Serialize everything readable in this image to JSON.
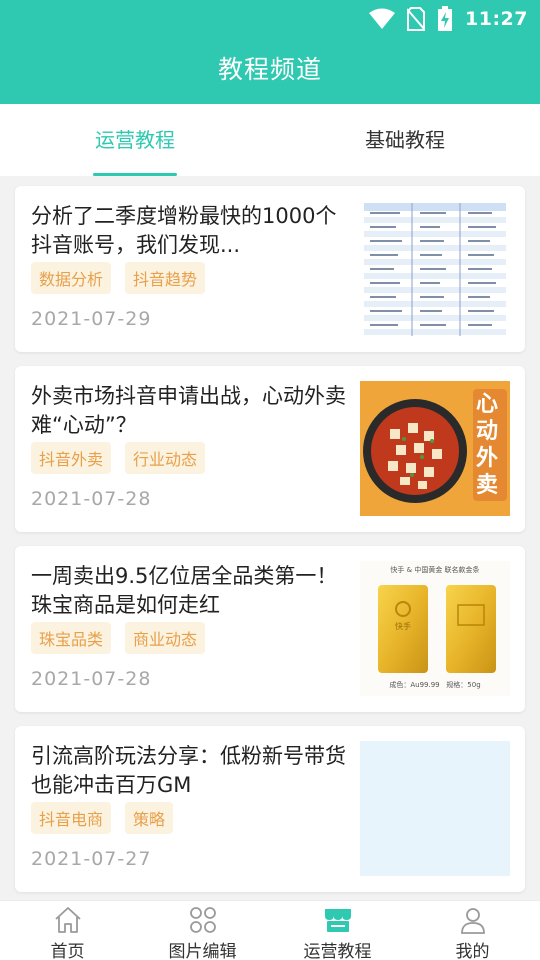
{
  "status_bar": {
    "time": "11:27"
  },
  "header": {
    "title": "教程频道"
  },
  "tabs": [
    {
      "label": "运营教程",
      "active": true
    },
    {
      "label": "基础教程",
      "active": false
    }
  ],
  "articles": [
    {
      "title": "分析了二季度增粉最快的1000个抖音账号，我们发现...",
      "tags": [
        "数据分析",
        "抖音趋势"
      ],
      "date": "2021-07-29",
      "thumb": "data-table"
    },
    {
      "title": "外卖市场抖音申请出战，心动外卖难“心动”？",
      "tags": [
        "抖音外卖",
        "行业动态"
      ],
      "date": "2021-07-28",
      "thumb": "food",
      "thumb_text": "心动外卖"
    },
    {
      "title": "一周卖出9.5亿位居全品类第一！珠宝商品是如何走红",
      "tags": [
        "珠宝品类",
        "商业动态"
      ],
      "date": "2021-07-28",
      "thumb": "gold-bars",
      "thumb_header": "快手 & 中国黄金 联名款金条",
      "thumb_footer": "成色：Au99.99   规格：50g",
      "bar_brand": "快手"
    },
    {
      "title": "引流高阶玩法分享：低粉新号带货也能冲击百万GM",
      "tags": [
        "抖音电商",
        "策略"
      ],
      "date": "2021-07-27",
      "thumb": "blank"
    }
  ],
  "bottom_nav": [
    {
      "label": "首页",
      "icon": "home-icon",
      "active": false
    },
    {
      "label": "图片编辑",
      "icon": "grid-icon",
      "active": false
    },
    {
      "label": "运营教程",
      "icon": "shop-icon",
      "active": true
    },
    {
      "label": "我的",
      "icon": "user-icon",
      "active": false
    }
  ],
  "colors": {
    "accent": "#2ec9b0",
    "tag_bg": "#fbf2df",
    "tag_text": "#e8a04b",
    "date": "#a8a8a8"
  }
}
